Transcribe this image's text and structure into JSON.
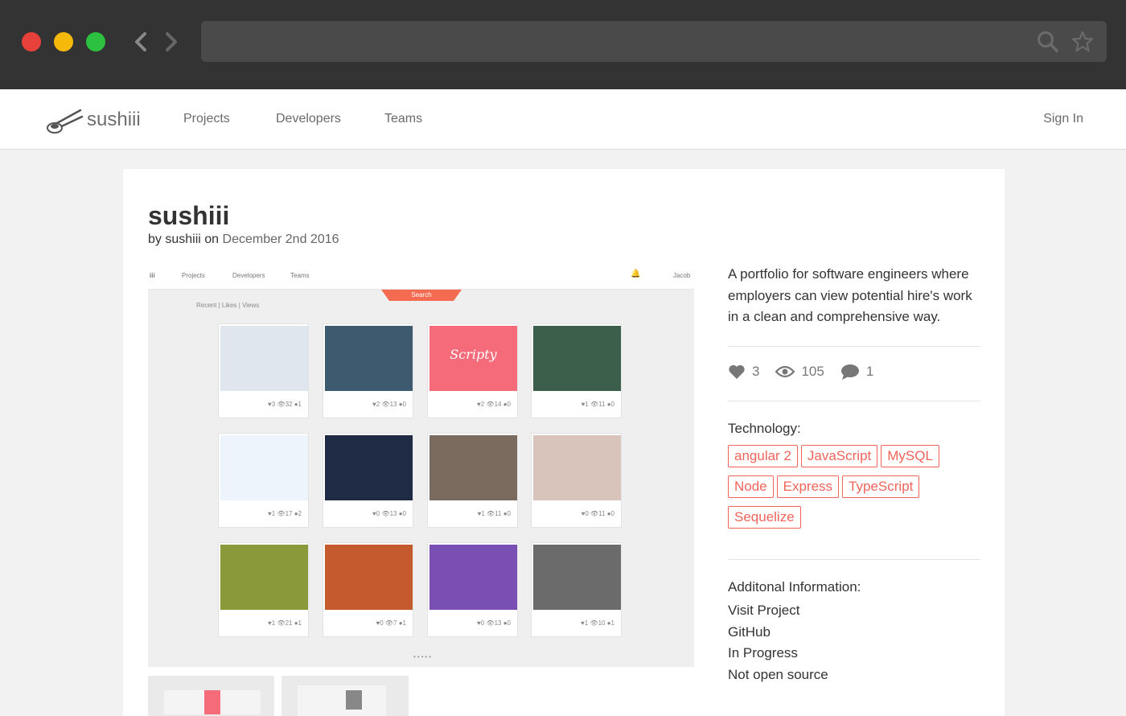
{
  "browser": {
    "icons": [
      "back-arrow-icon",
      "forward-arrow-icon",
      "search-icon",
      "star-icon"
    ]
  },
  "header": {
    "logo_text": "sushiii",
    "nav": {
      "projects": "Projects",
      "developers": "Developers",
      "teams": "Teams"
    },
    "sign_in": "Sign In"
  },
  "project": {
    "title": "sushiii",
    "by_prefix": "by",
    "author": "sushiii",
    "on_word": "on",
    "date": "December 2nd 2016",
    "description": "A portfolio for software engineers where employers can view potential hire's work in a clean and comprehensive way.",
    "stats": {
      "likes": "3",
      "views": "105",
      "comments": "1"
    },
    "technology_label": "Technology:",
    "technologies": [
      "angular 2",
      "JavaScript",
      "MySQL",
      "Node",
      "Express",
      "TypeScript",
      "Sequelize"
    ],
    "additional_label": "Additonal Information:",
    "additional": {
      "visit": "Visit Project",
      "github": "GitHub",
      "status": "In Progress",
      "source": "Not open source"
    }
  },
  "screenshot": {
    "nav": {
      "logo": "iii",
      "projects": "Projects",
      "developers": "Developers",
      "teams": "Teams",
      "user": "Jacob"
    },
    "search": "Search",
    "tabs": "Recent | Likes | Views",
    "tiles": [
      {
        "stats": "♥3 👁32 ●1",
        "color": "#dfe6ee"
      },
      {
        "stats": "♥2 👁13 ●0",
        "color": "#3d5a6e"
      },
      {
        "stats": "♥2 👁14 ●0",
        "color": "#f56b7a",
        "label": "Scripty"
      },
      {
        "stats": "♥1 👁11 ●0",
        "color": "#3b5f4a"
      },
      {
        "stats": "♥1 👁17 ●2",
        "color": "#eef4fb"
      },
      {
        "stats": "♥0 👁13 ●0",
        "color": "#1f2a44"
      },
      {
        "stats": "♥1 👁11 ●0",
        "color": "#7b6a5e"
      },
      {
        "stats": "♥0 👁11 ●0",
        "color": "#d9c4bc"
      },
      {
        "stats": "♥1 👁21 ●1",
        "color": "#8a9a3a"
      },
      {
        "stats": "♥0 👁7 ●1",
        "color": "#c45a2e"
      },
      {
        "stats": "♥0 👁13 ●0",
        "color": "#7a4fb4"
      },
      {
        "stats": "♥1 👁10 ●1",
        "color": "#6b6b6b"
      }
    ]
  }
}
